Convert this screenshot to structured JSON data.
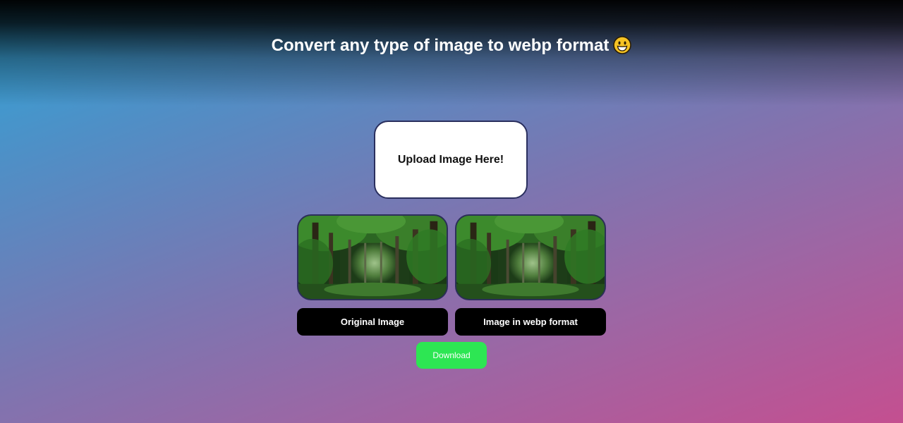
{
  "header": {
    "title": "Convert any type of image to webp format",
    "emoji_icon": "grinning-face-icon"
  },
  "upload": {
    "label": "Upload Image Here!"
  },
  "previews": [
    {
      "caption": "Original Image",
      "image": "forest-image"
    },
    {
      "caption": "Image in webp format",
      "image": "forest-image"
    }
  ],
  "actions": {
    "download_label": "Download"
  },
  "colors": {
    "download_button": "#2de653",
    "caption_background": "#000000",
    "gradient_start": "#2ea6d8",
    "gradient_end": "#c44f90"
  }
}
